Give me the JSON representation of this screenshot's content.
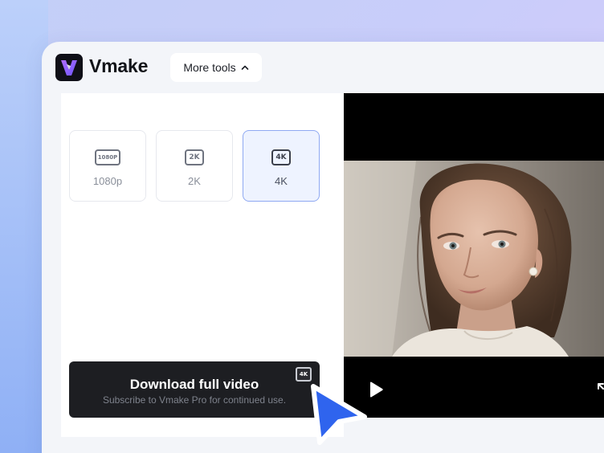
{
  "brand": {
    "name": "Vmake",
    "accent": "#9b5cff"
  },
  "header": {
    "more_tools_label": "More tools"
  },
  "resolutions": [
    {
      "badge": "1080P",
      "label": "1080p",
      "selected": false
    },
    {
      "badge": "2K",
      "label": "2K",
      "selected": false
    },
    {
      "badge": "4K",
      "label": "4K",
      "selected": true
    }
  ],
  "download": {
    "title": "Download full video",
    "subtitle": "Subscribe to Vmake Pro for continued use.",
    "badge": "4K"
  },
  "colors": {
    "selected_border": "#8fa9f2",
    "selected_bg": "#eef3ff",
    "button_bg": "#1d1e22",
    "cursor": "#2f64ee"
  },
  "icons": {
    "more_tools": "chevron-up-icon",
    "play": "play-icon",
    "expand": "expand-icon",
    "cursor": "pointer-cursor-icon"
  }
}
